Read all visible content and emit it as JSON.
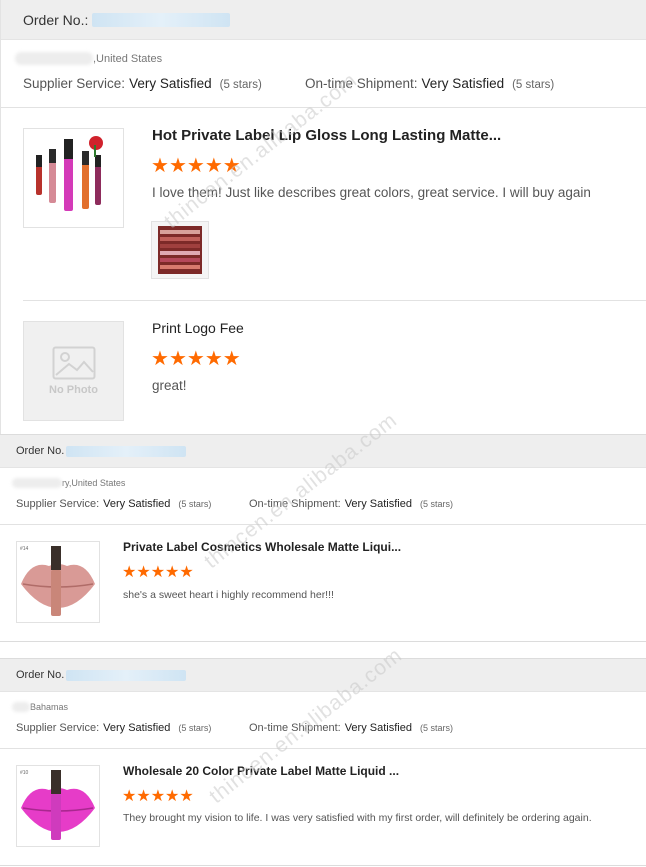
{
  "reviews": [
    {
      "order_label": "Order No.:",
      "location": ",United States",
      "supplier_service_label": "Supplier Service:",
      "supplier_service_value": "Very Satisfied",
      "supplier_service_stars": "(5 stars)",
      "shipment_label": "On-time Shipment:",
      "shipment_value": "Very Satisfied",
      "shipment_stars": "(5 stars)",
      "products": [
        {
          "title": "Hot Private Label Lip Gloss Long Lasting Matte...",
          "rating": 5,
          "review": "I love them! Just like describes great colors, great service. I will buy again",
          "has_photo": true,
          "has_review_image": true
        },
        {
          "title": "Print Logo Fee",
          "rating": 5,
          "review": "great!",
          "has_photo": false,
          "no_photo_text": "No Photo"
        }
      ]
    },
    {
      "order_label": "Order No.",
      "location": "ry,United States",
      "supplier_service_label": "Supplier Service:",
      "supplier_service_value": "Very Satisfied",
      "supplier_service_stars": "(5 stars)",
      "shipment_label": "On-time Shipment:",
      "shipment_value": "Very Satisfied",
      "shipment_stars": "(5 stars)",
      "products": [
        {
          "title": "Private Label Cosmetics Wholesale Matte Liqui...",
          "rating": 5,
          "review": "she's a sweet heart i highly recommend her!!!",
          "has_photo": true,
          "lip_color": "#d99a96",
          "tube_color": "#c98679",
          "tag": "#14"
        }
      ]
    },
    {
      "order_label": "Order No.",
      "location": "Bahamas",
      "supplier_service_label": "Supplier Service:",
      "supplier_service_value": "Very Satisfied",
      "supplier_service_stars": "(5 stars)",
      "shipment_label": "On-time Shipment:",
      "shipment_value": "Very Satisfied",
      "shipment_stars": "(5 stars)",
      "products": [
        {
          "title": "Wholesale 20 Color Private Label Matte Liquid ...",
          "rating": 5,
          "review": "They brought my vision to life. I was very satisfied with my first order, will definitely be ordering again.",
          "has_photo": true,
          "lip_color": "#e63cc8",
          "tube_color": "#cf3bbd",
          "tag": "#10"
        }
      ]
    }
  ],
  "watermark": "thincen.en.alibaba.com",
  "colors": {
    "star": "#ff6a00",
    "order_bar": "#eeeeee"
  },
  "icons": {
    "star": "star-icon",
    "no_photo": "image-placeholder-icon"
  }
}
